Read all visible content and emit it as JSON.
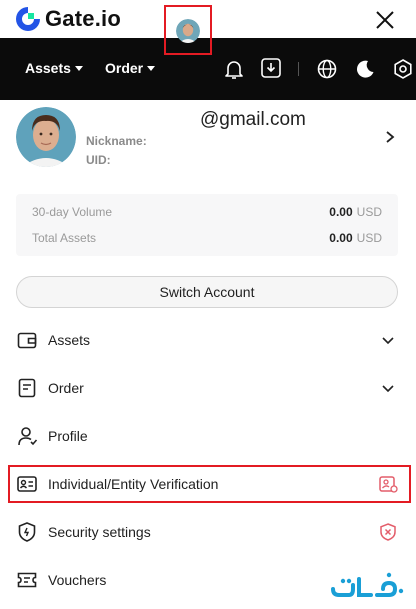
{
  "header": {
    "brand": "Gate.io",
    "close_icon": "close-icon"
  },
  "nav": {
    "assets_label": "Assets",
    "order_label": "Order",
    "icons": [
      "avatar",
      "bell-icon",
      "download-icon",
      "globe-icon",
      "moon-icon",
      "settings-icon"
    ]
  },
  "profile": {
    "email": "@gmail.com",
    "nickname_label": "Nickname:",
    "uid_label": "UID:"
  },
  "stats": {
    "volume_label": "30-day Volume",
    "volume_value": "0.00",
    "volume_unit": "USD",
    "assets_label": "Total Assets",
    "assets_value": "0.00",
    "assets_unit": "USD"
  },
  "switch_account_label": "Switch Account",
  "menu": {
    "assets": "Assets",
    "order": "Order",
    "profile": "Profile",
    "verification": "Individual/Entity Verification",
    "security": "Security settings",
    "vouchers": "Vouchers"
  },
  "colors": {
    "highlight": "#e31b23",
    "nav_bg": "#0b0b0b",
    "brand_blue": "#2354e6",
    "brand_green": "#17e6a1"
  }
}
